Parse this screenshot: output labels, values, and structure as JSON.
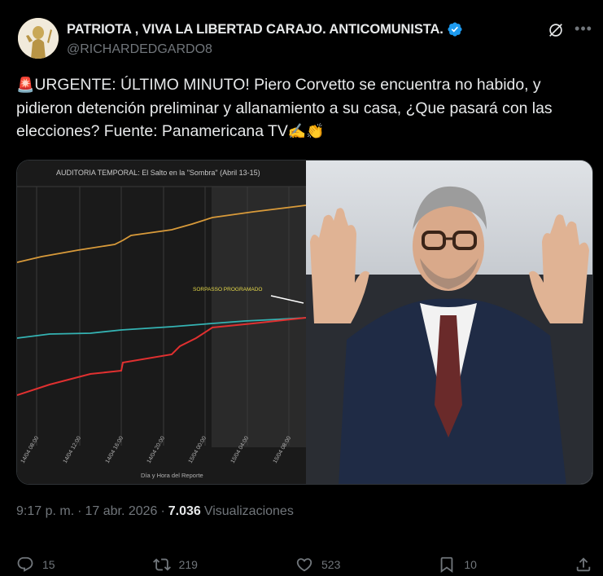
{
  "author": {
    "display_name": "PATRIOTA , VIVA LA LIBERTAD CARAJO. ANTICOMUNISTA.",
    "handle": "@RICHARDEDGARDO8",
    "verified": true
  },
  "tweet": {
    "text_prefix_emoji": "🚨",
    "text": "URGENTE: ÚLTIMO MINUTO!  Piero Corvetto se encuentra no habido, y pidieron detención preliminar y allanamiento a su casa, ¿Que pasará con las elecciones?   Fuente: Panamericana TV",
    "text_suffix_emoji": "✍️👏"
  },
  "media": {
    "chart": {
      "title": "AUDITORIA TEMPORAL: El Salto en la \"Sombra\" (Abril 13-15)",
      "annotation": "SORPASSO PROGRAMADO",
      "xlabel": "Día y Hora del Reporte",
      "x_ticks": [
        "14/04 08:00",
        "14/04 12:00",
        "14/04 16:00",
        "14/04 20:00",
        "15/04 00:00",
        "15/04 04:00",
        "15/04 08:00"
      ]
    }
  },
  "meta": {
    "time": "9:17 p. m.",
    "separator": "·",
    "date": "17 abr. 2026",
    "separator2": "·",
    "views_count": "7.036",
    "views_label": "Visualizaciones"
  },
  "actions": {
    "replies": "15",
    "reposts": "219",
    "likes": "523",
    "bookmarks": "10"
  },
  "colors": {
    "accent_verified": "#1d9bf0",
    "muted": "#71767b",
    "text": "#e7e9ea",
    "background": "#000000"
  }
}
